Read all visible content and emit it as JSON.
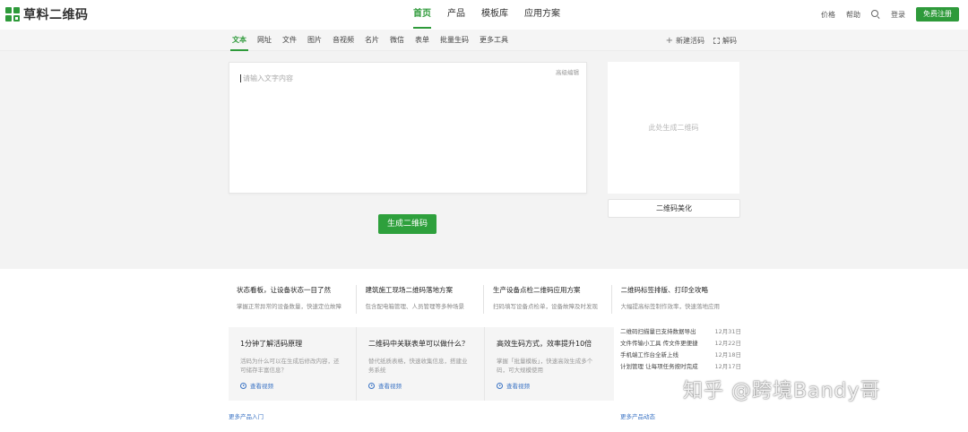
{
  "brand": {
    "name": "草料二维码",
    "color": "#2e9a3a"
  },
  "main_nav": {
    "items": [
      {
        "label": "首页",
        "active": true
      },
      {
        "label": "产品",
        "active": false
      },
      {
        "label": "模板库",
        "active": false
      },
      {
        "label": "应用方案",
        "active": false
      }
    ]
  },
  "right_nav": {
    "price": "价格",
    "help": "帮助",
    "search_icon": "search-icon",
    "login": "登录",
    "register": "免费注册"
  },
  "sub_tabs": {
    "items": [
      {
        "label": "文本",
        "active": true
      },
      {
        "label": "网址",
        "active": false
      },
      {
        "label": "文件",
        "active": false
      },
      {
        "label": "图片",
        "active": false
      },
      {
        "label": "音视频",
        "active": false
      },
      {
        "label": "名片",
        "active": false
      },
      {
        "label": "微信",
        "active": false
      },
      {
        "label": "表单",
        "active": false
      },
      {
        "label": "批量生码",
        "active": false
      },
      {
        "label": "更多工具",
        "active": false
      }
    ],
    "new_live_code": "新建活码",
    "decode": "解码"
  },
  "editor": {
    "advanced_label": "高级编辑",
    "placeholder": "请输入文字内容"
  },
  "generate_button": "生成二维码",
  "qr_preview": {
    "placeholder": "此处生成二维码",
    "beautify_button": "二维码美化"
  },
  "cases": [
    {
      "title": "状态看板，让设备状态一目了然",
      "desc": "掌握正常异常的设备数量，快速定位故障"
    },
    {
      "title": "建筑施工现场二维码落地方案",
      "desc": "包含配电箱管理、人员管理等多种场景"
    },
    {
      "title": "生产设备点检二维码应用方案",
      "desc": "扫码填写设备点检单，设备故障及时发现"
    },
    {
      "title": "二维码标签排版、打印全攻略",
      "desc": "大幅提高标签制作效率，快速落地应用"
    }
  ],
  "guides": [
    {
      "title": "1分钟了解活码原理",
      "desc": "活码为什么可以在生成后修改内容，还可储存丰富信息？",
      "video": "查看视频"
    },
    {
      "title": "二维码中关联表单可以做什么？",
      "desc": "替代纸质表格，快速收集信息，搭建业务系统",
      "video": "查看视频"
    },
    {
      "title": "高效生码方式，效率提升10倍",
      "desc": "掌握「批量模板」，快速高效生成多个码，可大规模使用",
      "video": "查看视频"
    }
  ],
  "news": [
    {
      "title": "二维码扫描量已支持数据导出",
      "date": "12月31日"
    },
    {
      "title": "文件传输小工具 传文件更便捷",
      "date": "12月22日"
    },
    {
      "title": "手机端工作台全新上线",
      "date": "12月18日"
    },
    {
      "title": "计划管理 让每项任务按时完成",
      "date": "12月17日"
    }
  ],
  "more_product": "更多产品入门",
  "more_news": "更多产品动态",
  "watermark": "知乎 @跨境Bandy哥"
}
